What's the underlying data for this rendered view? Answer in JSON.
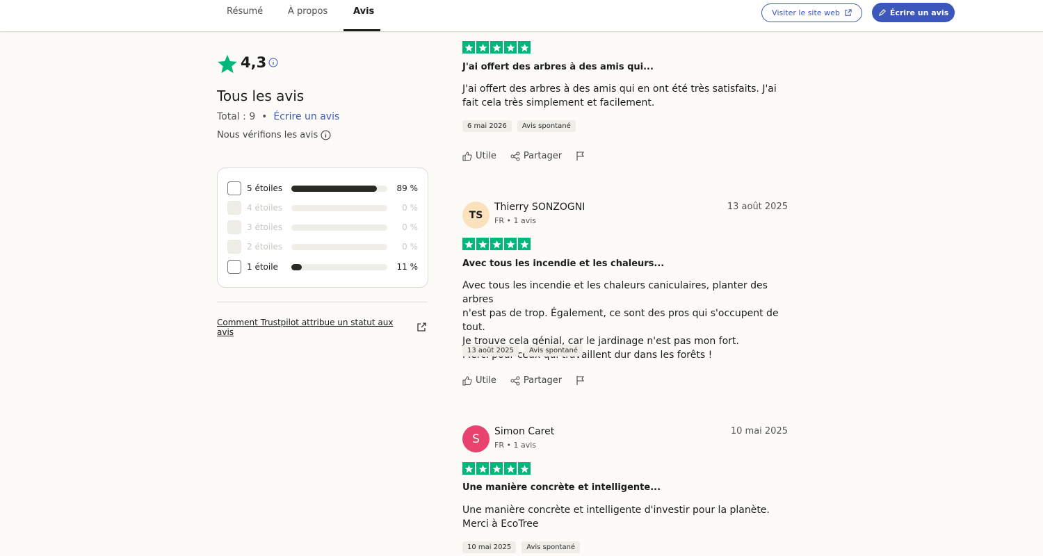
{
  "nav": {
    "tabs": [
      "Résumé",
      "À propos",
      "Avis"
    ],
    "visit_label": "Visiter le site web",
    "write_label": "Écrire un avis"
  },
  "summary": {
    "rating": "4,3",
    "title": "Tous les avis",
    "total": "Total : 9",
    "sep": "•",
    "write_link": "Écrire un avis",
    "verify": "Nous vérifions les avis"
  },
  "filters": [
    {
      "label": "5 étoiles",
      "pct": "89 %",
      "fill": 0.89,
      "enabled": true
    },
    {
      "label": "4 étoiles",
      "pct": "0 %",
      "fill": 0,
      "enabled": false
    },
    {
      "label": "3 étoiles",
      "pct": "0 %",
      "fill": 0,
      "enabled": false
    },
    {
      "label": "2 étoiles",
      "pct": "0 %",
      "fill": 0,
      "enabled": false
    },
    {
      "label": "1 étoile",
      "pct": "11 %",
      "fill": 0.11,
      "enabled": true
    }
  ],
  "trustpilot_link": "Comment Trustpilot attribue un statut aux avis",
  "actions": {
    "useful": "Utile",
    "share": "Partager"
  },
  "colors": {
    "accent": "#3c57bc",
    "star_green": "#00b67a",
    "bar_dark": "#2b2b26"
  },
  "reviews": [
    {
      "title": "J'ai offert des arbres à des amis qui...",
      "body": "J'ai offert des arbres à des amis qui en ont été très satisfaits. J'ai fait cela très simplement et facilement.",
      "date_tag": "6 mai 2026",
      "type_tag": "Avis spontané"
    },
    {
      "initials": "TS",
      "name": "Thierry SONZOGNI",
      "meta": "FR • 1 avis",
      "date": "13 août 2025",
      "title": "Avec tous les incendie et les chaleurs...",
      "body_lines": [
        "Avec tous les incendie et les chaleurs caniculaires, planter des arbres",
        "n'est pas de trop. Également, ce sont des pros qui s'occupent de tout.",
        "Je trouve cela génial, car le jardinage n'est pas mon fort.",
        "Merci pour ceux qui travaillent dur dans les forêts !"
      ],
      "date_tag": "13 août 2025",
      "type_tag": "Avis spontané"
    },
    {
      "initials": "S",
      "name": "Simon Caret",
      "meta": "FR • 1 avis",
      "date": "10 mai 2025",
      "title": "Une manière concrète et intelligente...",
      "body": "Une manière concrète et intelligente d'investir pour la planète. Merci à EcoTree",
      "date_tag": "10 mai 2025",
      "type_tag": "Avis spontané"
    }
  ]
}
